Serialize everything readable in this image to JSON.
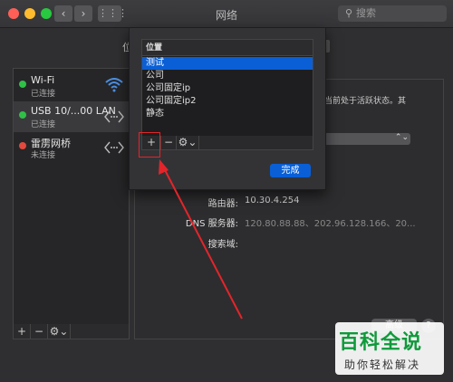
{
  "window": {
    "title": "网络",
    "search_placeholder": "搜索",
    "nav_back": "‹",
    "nav_forward": "›",
    "grid_glyph": "⋮⋮⋮"
  },
  "location_label_fragment": "位",
  "services": [
    {
      "name": "Wi-Fi",
      "status": "已连接",
      "status_color": "#30c048",
      "icon": "wifi-icon"
    },
    {
      "name": "USB 10/...00 LAN",
      "status": "已连接",
      "status_color": "#30c048",
      "icon": "ethernet-icon"
    },
    {
      "name": "雷雳网桥",
      "status": "未连接",
      "status_color": "#e5483d",
      "icon": "ethernet-icon"
    }
  ],
  "sidebar_toolbar": {
    "add": "+",
    "remove": "−",
    "gear": "⚙⌄"
  },
  "status_fragment": "当前处于活跃状态。其",
  "details": {
    "router_label": "路由器:",
    "router_value": "10.30.4.254",
    "dns_label": "DNS 服务器:",
    "dns_value": "120.80.88.88、202.96.128.166、20...",
    "search_domain_label": "搜索域:"
  },
  "advanced_fragment": "高级",
  "help": "?",
  "location_sheet": {
    "header": "位置",
    "items": [
      "测试",
      "公司",
      "公司固定ip",
      "公司固定ip2",
      "静态"
    ],
    "selected_index": 0,
    "add": "+",
    "remove": "−",
    "gear": "⚙⌄",
    "done": "完成"
  },
  "annotation_color": "#e3252a",
  "watermark": {
    "title": "百科全说",
    "subtitle": "助你轻松解决"
  }
}
